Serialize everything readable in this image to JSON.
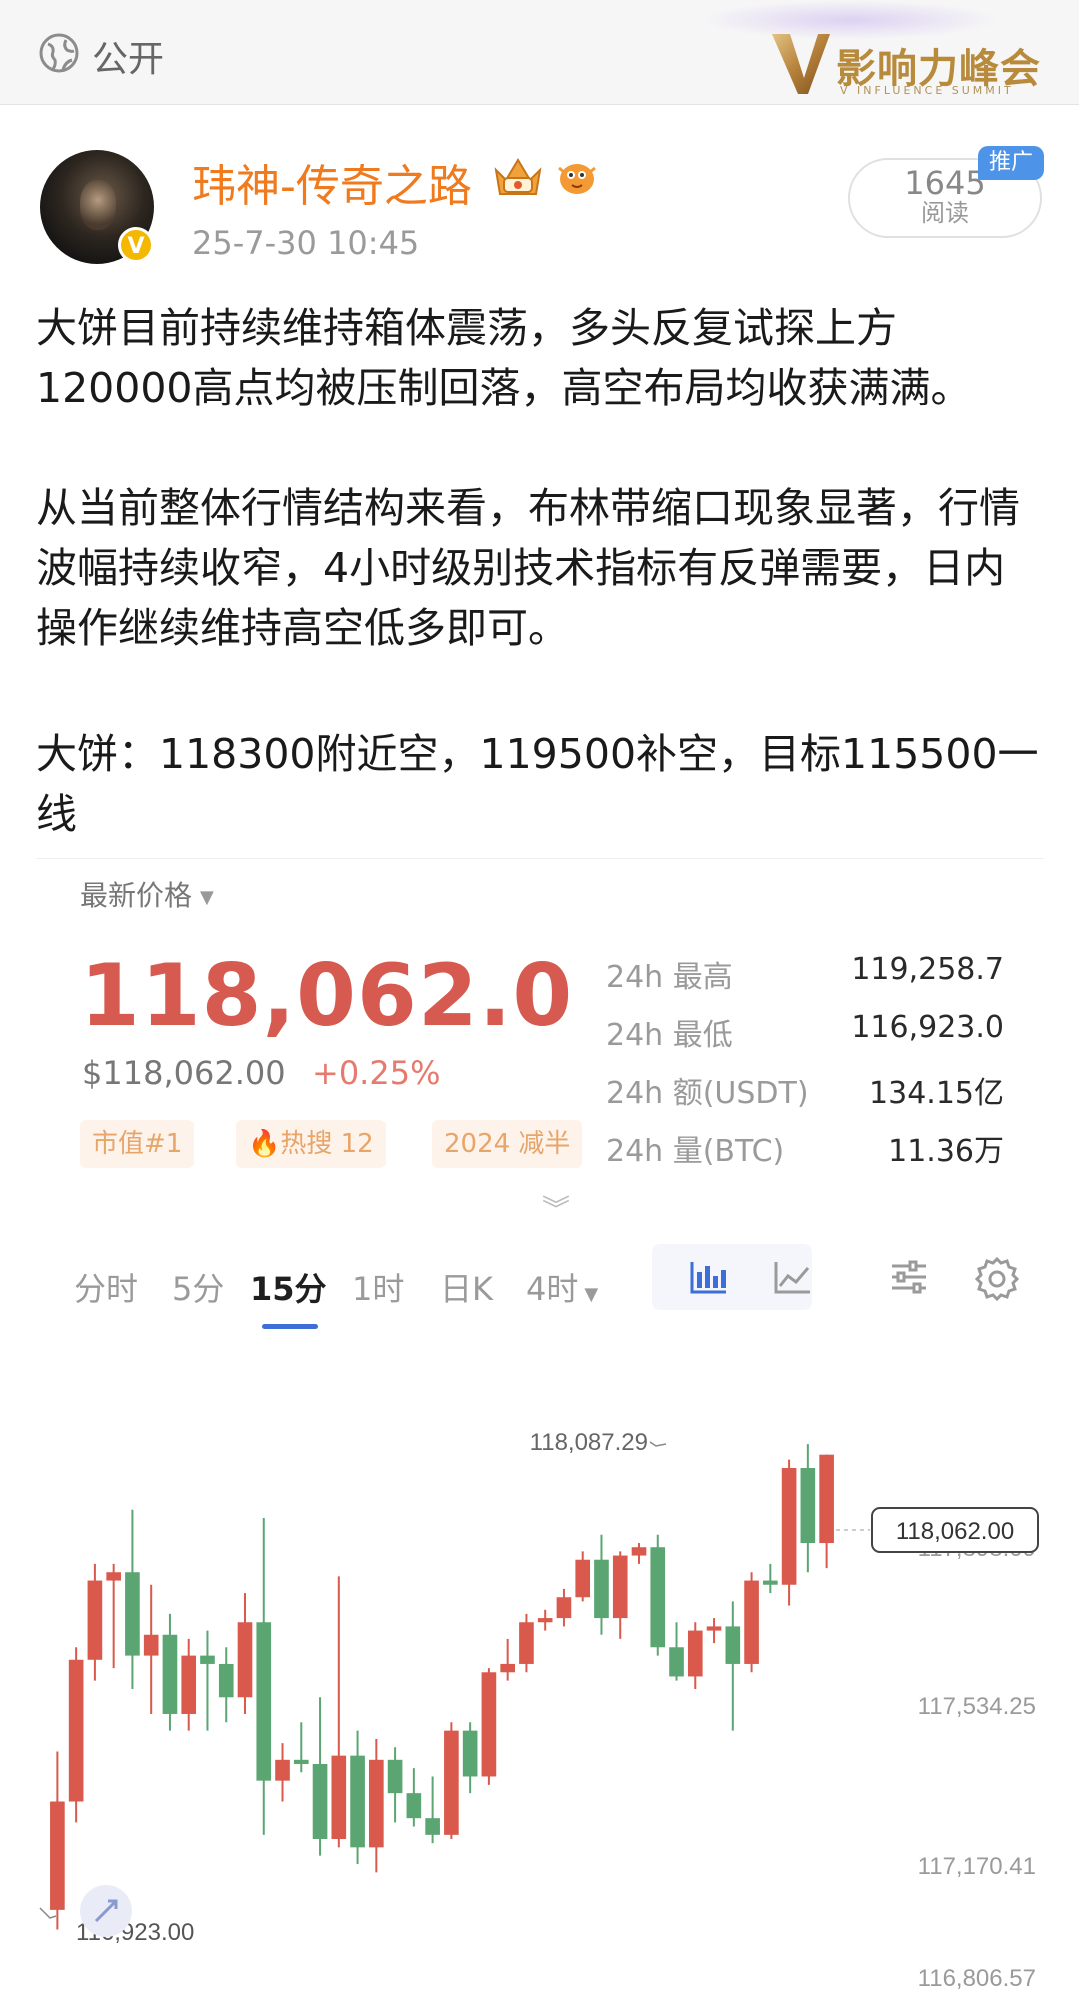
{
  "topbar": {
    "visibility_label": "公开",
    "brand_text": "影响力峰会",
    "brand_sub": "V INFLUENCE SUMMIT"
  },
  "post": {
    "username": "玮神-传奇之路",
    "time": "25-7-30 10:45",
    "read_count": "1645",
    "read_label": "阅读",
    "promo_label": "推广",
    "paragraphs": [
      "大饼目前持续维持箱体震荡，多头反复试探上方120000高点均被压制回落，高空布局均收获满满。",
      "从当前整体行情结构来看，布林带缩口现象显著，行情波幅持续收窄，4小时级别技术指标有反弹需要，日内操作继续维持高空低多即可。",
      "大饼：118300附近空，119500补空，目标115500一线"
    ]
  },
  "market": {
    "latest_label": "最新价格",
    "price": "118,062.0",
    "usd_price": "$118,062.00",
    "change": "+0.25%",
    "tags": [
      "市值#1",
      "热搜 12",
      "2024 减半"
    ],
    "stats": [
      {
        "label": "24h 最高",
        "value": "119,258.7"
      },
      {
        "label": "24h 最低",
        "value": "116,923.0"
      },
      {
        "label": "24h 额(USDT)",
        "value": "134.15亿"
      },
      {
        "label": "24h 量(BTC)",
        "value": "11.36万"
      }
    ],
    "tabs": [
      "分时",
      "5分",
      "15分",
      "1时",
      "日K",
      "4时"
    ],
    "active_tab": "15分",
    "colors": {
      "up": "#d9594c",
      "down": "#5aa572",
      "accent": "#3e6fd8"
    }
  },
  "chart_data": {
    "type": "candlestick",
    "y_labels": [
      "118,062.00",
      "117,898.09",
      "117,534.25",
      "117,170.41",
      "116,806.57"
    ],
    "max_label": "118,087.29",
    "min_label": "116,923.00",
    "last_price": "118,062.00",
    "ylim": [
      116806.57,
      118150
    ],
    "candles": [
      {
        "o": 116970,
        "h": 117350,
        "l": 116923,
        "c": 117230
      },
      {
        "o": 117230,
        "h": 117600,
        "l": 117180,
        "c": 117570
      },
      {
        "o": 117570,
        "h": 117800,
        "l": 117520,
        "c": 117760
      },
      {
        "o": 117760,
        "h": 117800,
        "l": 117550,
        "c": 117780
      },
      {
        "o": 117780,
        "h": 117930,
        "l": 117500,
        "c": 117580
      },
      {
        "o": 117580,
        "h": 117750,
        "l": 117440,
        "c": 117630
      },
      {
        "o": 117630,
        "h": 117680,
        "l": 117400,
        "c": 117440
      },
      {
        "o": 117440,
        "h": 117620,
        "l": 117400,
        "c": 117580
      },
      {
        "o": 117580,
        "h": 117640,
        "l": 117400,
        "c": 117560
      },
      {
        "o": 117560,
        "h": 117600,
        "l": 117420,
        "c": 117480
      },
      {
        "o": 117480,
        "h": 117730,
        "l": 117440,
        "c": 117660
      },
      {
        "o": 117660,
        "h": 117910,
        "l": 117150,
        "c": 117280
      },
      {
        "o": 117280,
        "h": 117370,
        "l": 117230,
        "c": 117330
      },
      {
        "o": 117330,
        "h": 117420,
        "l": 117300,
        "c": 117320
      },
      {
        "o": 117320,
        "h": 117480,
        "l": 117100,
        "c": 117140
      },
      {
        "o": 117140,
        "h": 117770,
        "l": 117120,
        "c": 117340
      },
      {
        "o": 117340,
        "h": 117400,
        "l": 117080,
        "c": 117120
      },
      {
        "o": 117120,
        "h": 117380,
        "l": 117060,
        "c": 117330
      },
      {
        "o": 117330,
        "h": 117360,
        "l": 117180,
        "c": 117250
      },
      {
        "o": 117250,
        "h": 117310,
        "l": 117170,
        "c": 117190
      },
      {
        "o": 117190,
        "h": 117290,
        "l": 117130,
        "c": 117150
      },
      {
        "o": 117150,
        "h": 117420,
        "l": 117140,
        "c": 117400
      },
      {
        "o": 117400,
        "h": 117420,
        "l": 117250,
        "c": 117290
      },
      {
        "o": 117290,
        "h": 117550,
        "l": 117270,
        "c": 117540
      },
      {
        "o": 117540,
        "h": 117620,
        "l": 117520,
        "c": 117560
      },
      {
        "o": 117560,
        "h": 117680,
        "l": 117540,
        "c": 117660
      },
      {
        "o": 117660,
        "h": 117690,
        "l": 117640,
        "c": 117670
      },
      {
        "o": 117670,
        "h": 117740,
        "l": 117650,
        "c": 117720
      },
      {
        "o": 117720,
        "h": 117830,
        "l": 117710,
        "c": 117810
      },
      {
        "o": 117810,
        "h": 117870,
        "l": 117630,
        "c": 117670
      },
      {
        "o": 117670,
        "h": 117830,
        "l": 117620,
        "c": 117820
      },
      {
        "o": 117820,
        "h": 117850,
        "l": 117800,
        "c": 117840
      },
      {
        "o": 117840,
        "h": 117870,
        "l": 117580,
        "c": 117600
      },
      {
        "o": 117600,
        "h": 117660,
        "l": 117520,
        "c": 117530
      },
      {
        "o": 117530,
        "h": 117660,
        "l": 117500,
        "c": 117640
      },
      {
        "o": 117640,
        "h": 117670,
        "l": 117610,
        "c": 117650
      },
      {
        "o": 117650,
        "h": 117710,
        "l": 117400,
        "c": 117560
      },
      {
        "o": 117560,
        "h": 117780,
        "l": 117540,
        "c": 117760
      },
      {
        "o": 117760,
        "h": 117800,
        "l": 117730,
        "c": 117750
      },
      {
        "o": 117750,
        "h": 118050,
        "l": 117700,
        "c": 118030
      },
      {
        "o": 118030,
        "h": 118087.29,
        "l": 117780,
        "c": 117850
      },
      {
        "o": 117850,
        "h": 118062,
        "l": 117790,
        "c": 118062
      }
    ]
  }
}
